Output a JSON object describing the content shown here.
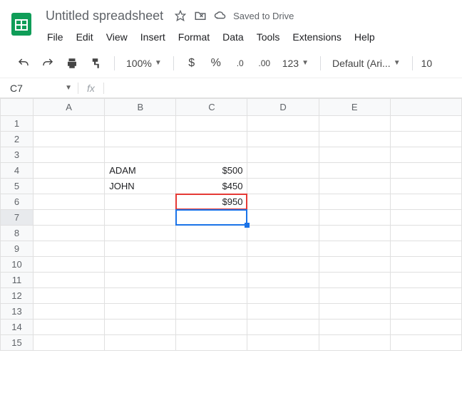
{
  "header": {
    "doc_title": "Untitled spreadsheet",
    "saved_status": "Saved to Drive"
  },
  "menu": {
    "file": "File",
    "edit": "Edit",
    "view": "View",
    "insert": "Insert",
    "format": "Format",
    "data": "Data",
    "tools": "Tools",
    "extensions": "Extensions",
    "help": "Help"
  },
  "toolbar": {
    "zoom": "100%",
    "currency": "$",
    "percent": "%",
    "dec_dec": ".0",
    "inc_dec": ".00",
    "num_format": "123",
    "font": "Default (Ari...",
    "font_size": "10"
  },
  "namebox": {
    "cell": "C7",
    "fx_label": "fx",
    "formula": ""
  },
  "columns": [
    "A",
    "B",
    "C",
    "D",
    "E"
  ],
  "rows": [
    "1",
    "2",
    "3",
    "4",
    "5",
    "6",
    "7",
    "8",
    "9",
    "10",
    "11",
    "12",
    "13",
    "14",
    "15"
  ],
  "cells": {
    "B4": "ADAM",
    "B5": "JOHN",
    "C4": "$500",
    "C5": "$450",
    "C6": "$950"
  },
  "highlight": {
    "cell": "C6"
  },
  "selection": {
    "cell": "C7"
  }
}
